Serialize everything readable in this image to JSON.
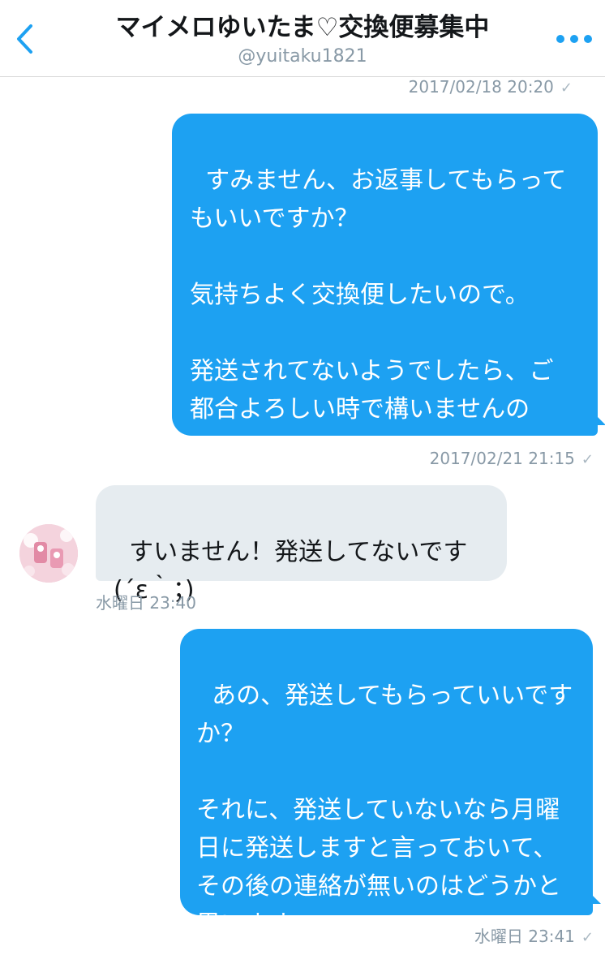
{
  "header": {
    "title": "マイメロゆいたま♡交換便募集中",
    "handle": "@yuitaku1821"
  },
  "colors": {
    "accent": "#1da1f2",
    "incoming_bubble": "#e6ecf0",
    "meta_text": "#8899a6"
  },
  "messages": [
    {
      "direction": "meta",
      "time": "2017/02/18 20:20",
      "check": "✓"
    },
    {
      "direction": "outgoing",
      "text": "すみません、お返事してもらってもいいですか？\n\n気持ちよく交換便したいので。\n\n発送されてないようでしたら、ご都合よろしい時で構いませんので。",
      "time": "2017/02/21 21:15",
      "check": "✓"
    },
    {
      "direction": "incoming",
      "text": "すいません！発送してないです(´ε｀；)",
      "time": "水曜日 23:40"
    },
    {
      "direction": "outgoing",
      "text": "あの、発送してもらっていいですか？\n\nそれに、発送していないなら月曜日に発送しますと言っておいて、その後の連絡が無いのはどうかと思います。",
      "time": "水曜日 23:41",
      "check": "✓"
    }
  ],
  "icons": {
    "back": "chevron-left-icon",
    "more": "more-dots-icon"
  }
}
